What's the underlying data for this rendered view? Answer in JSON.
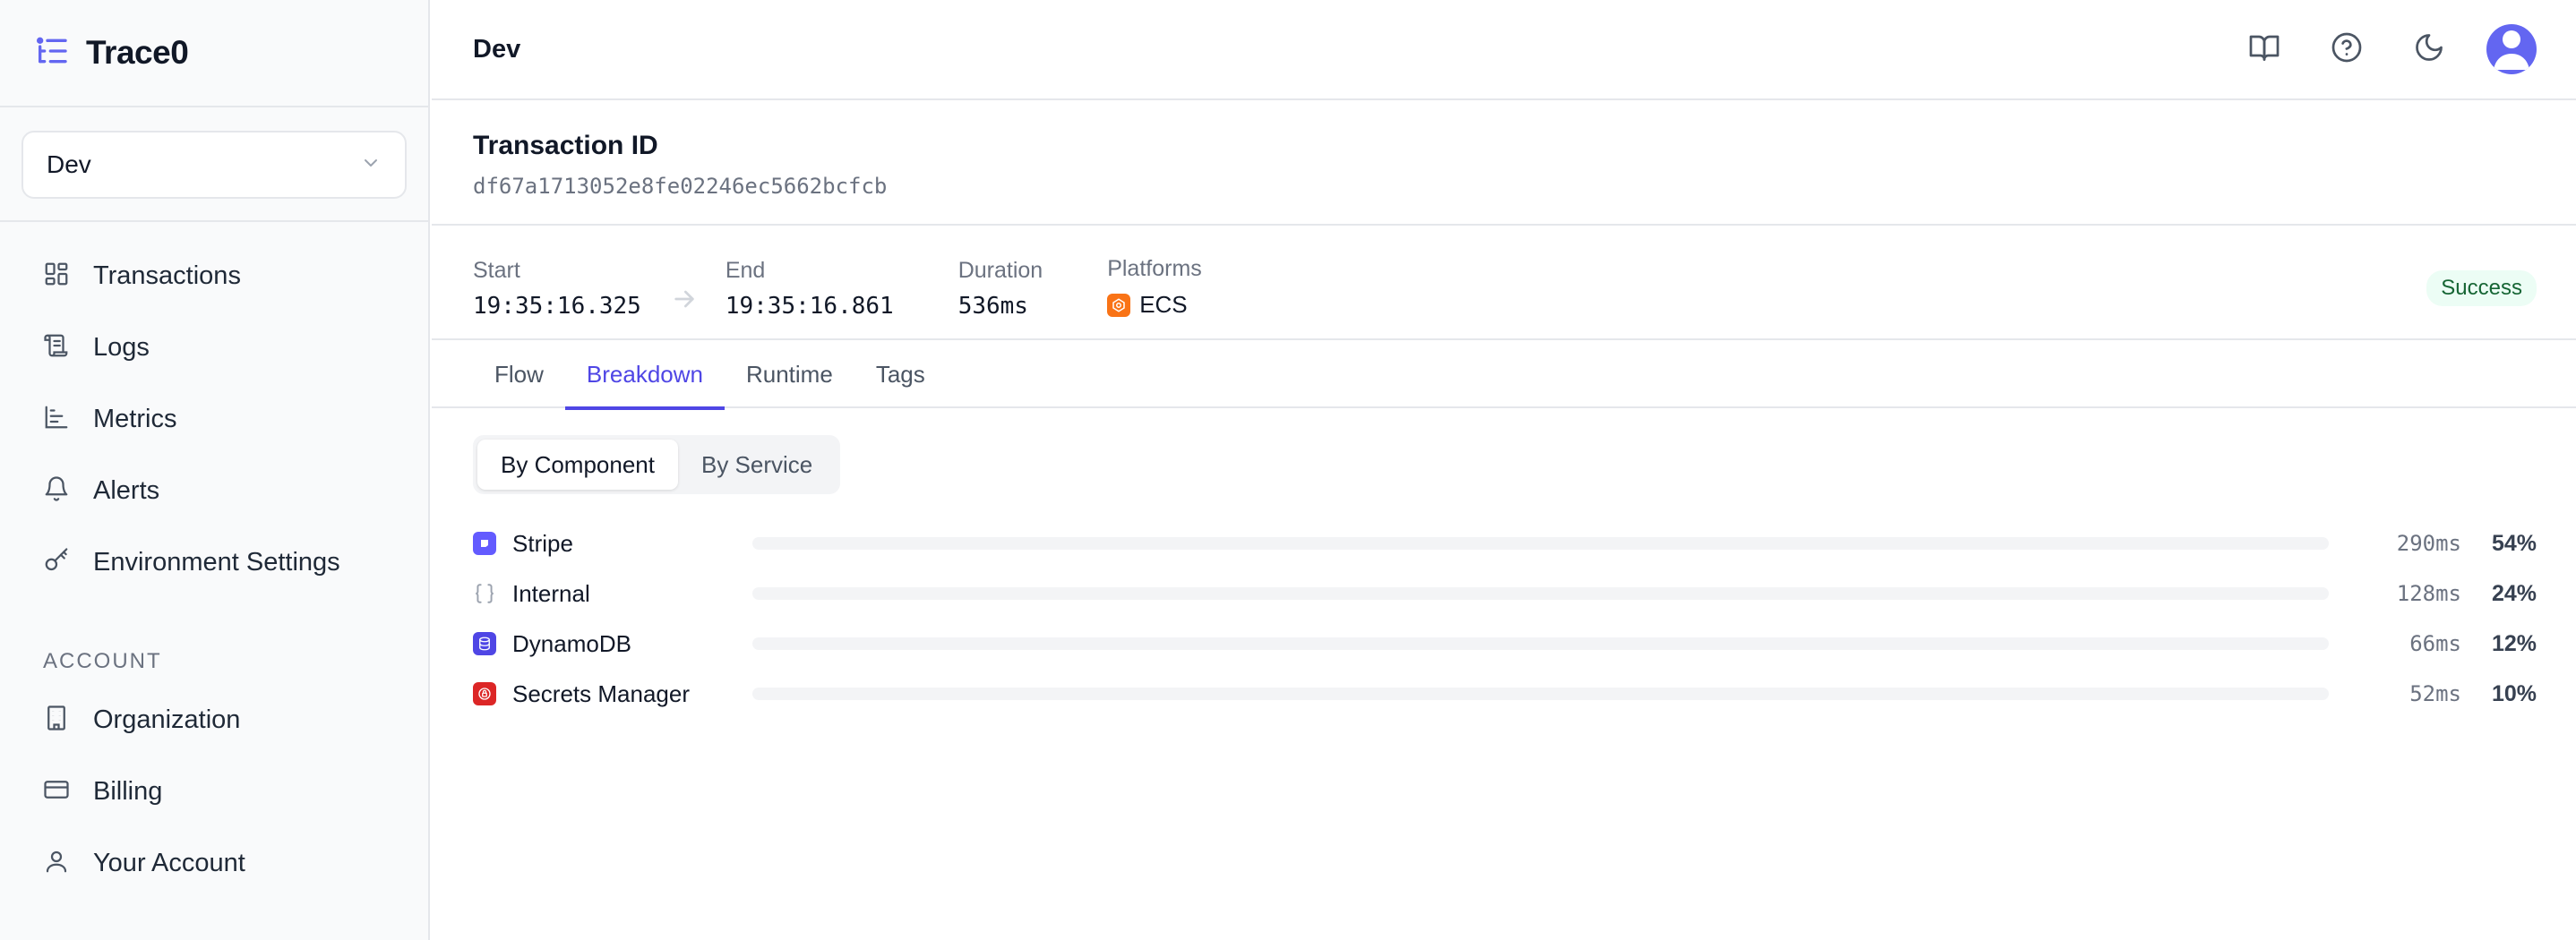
{
  "brand": {
    "name": "Trace0"
  },
  "sidebar": {
    "environment_selected": "Dev",
    "nav": [
      {
        "label": "Transactions",
        "icon": "grid-icon"
      },
      {
        "label": "Logs",
        "icon": "scroll-icon"
      },
      {
        "label": "Metrics",
        "icon": "bar-chart-icon"
      },
      {
        "label": "Alerts",
        "icon": "bell-icon"
      },
      {
        "label": "Environment Settings",
        "icon": "key-icon"
      }
    ],
    "account_section": "ACCOUNT",
    "account_nav": [
      {
        "label": "Organization",
        "icon": "building-icon"
      },
      {
        "label": "Billing",
        "icon": "credit-card-icon"
      },
      {
        "label": "Your Account",
        "icon": "user-icon"
      }
    ]
  },
  "header": {
    "title": "Dev"
  },
  "transaction": {
    "id_label": "Transaction ID",
    "id": "df67a1713052e8fe02246ec5662bcfcb"
  },
  "meta": {
    "start_label": "Start",
    "start": "19:35:16.325",
    "end_label": "End",
    "end": "19:35:16.861",
    "duration_label": "Duration",
    "duration": "536ms",
    "platforms_label": "Platforms",
    "platform": "ECS",
    "status": "Success"
  },
  "tabs": [
    "Flow",
    "Breakdown",
    "Runtime",
    "Tags"
  ],
  "active_tab": "Breakdown",
  "view_toggle": [
    "By Component",
    "By Service"
  ],
  "active_view": "By Component",
  "breakdown": [
    {
      "name": "Stripe",
      "ms": "290ms",
      "pct": "54%",
      "fraction": 0.54,
      "icon": "stripe-icon",
      "color": "#635bff"
    },
    {
      "name": "Internal",
      "ms": "128ms",
      "pct": "24%",
      "fraction": 0.24,
      "icon": "braces-icon",
      "color": "#9ca3af"
    },
    {
      "name": "DynamoDB",
      "ms": "66ms",
      "pct": "12%",
      "fraction": 0.12,
      "icon": "dynamodb-icon",
      "color": "#4f46e5"
    },
    {
      "name": "Secrets Manager",
      "ms": "52ms",
      "pct": "10%",
      "fraction": 0.1,
      "icon": "secrets-manager-icon",
      "color": "#dc2626"
    }
  ],
  "colors": {
    "accent": "#4f46e5",
    "bar": "#6366f1",
    "success_bg": "#ecfdf5",
    "success_text": "#166534"
  }
}
